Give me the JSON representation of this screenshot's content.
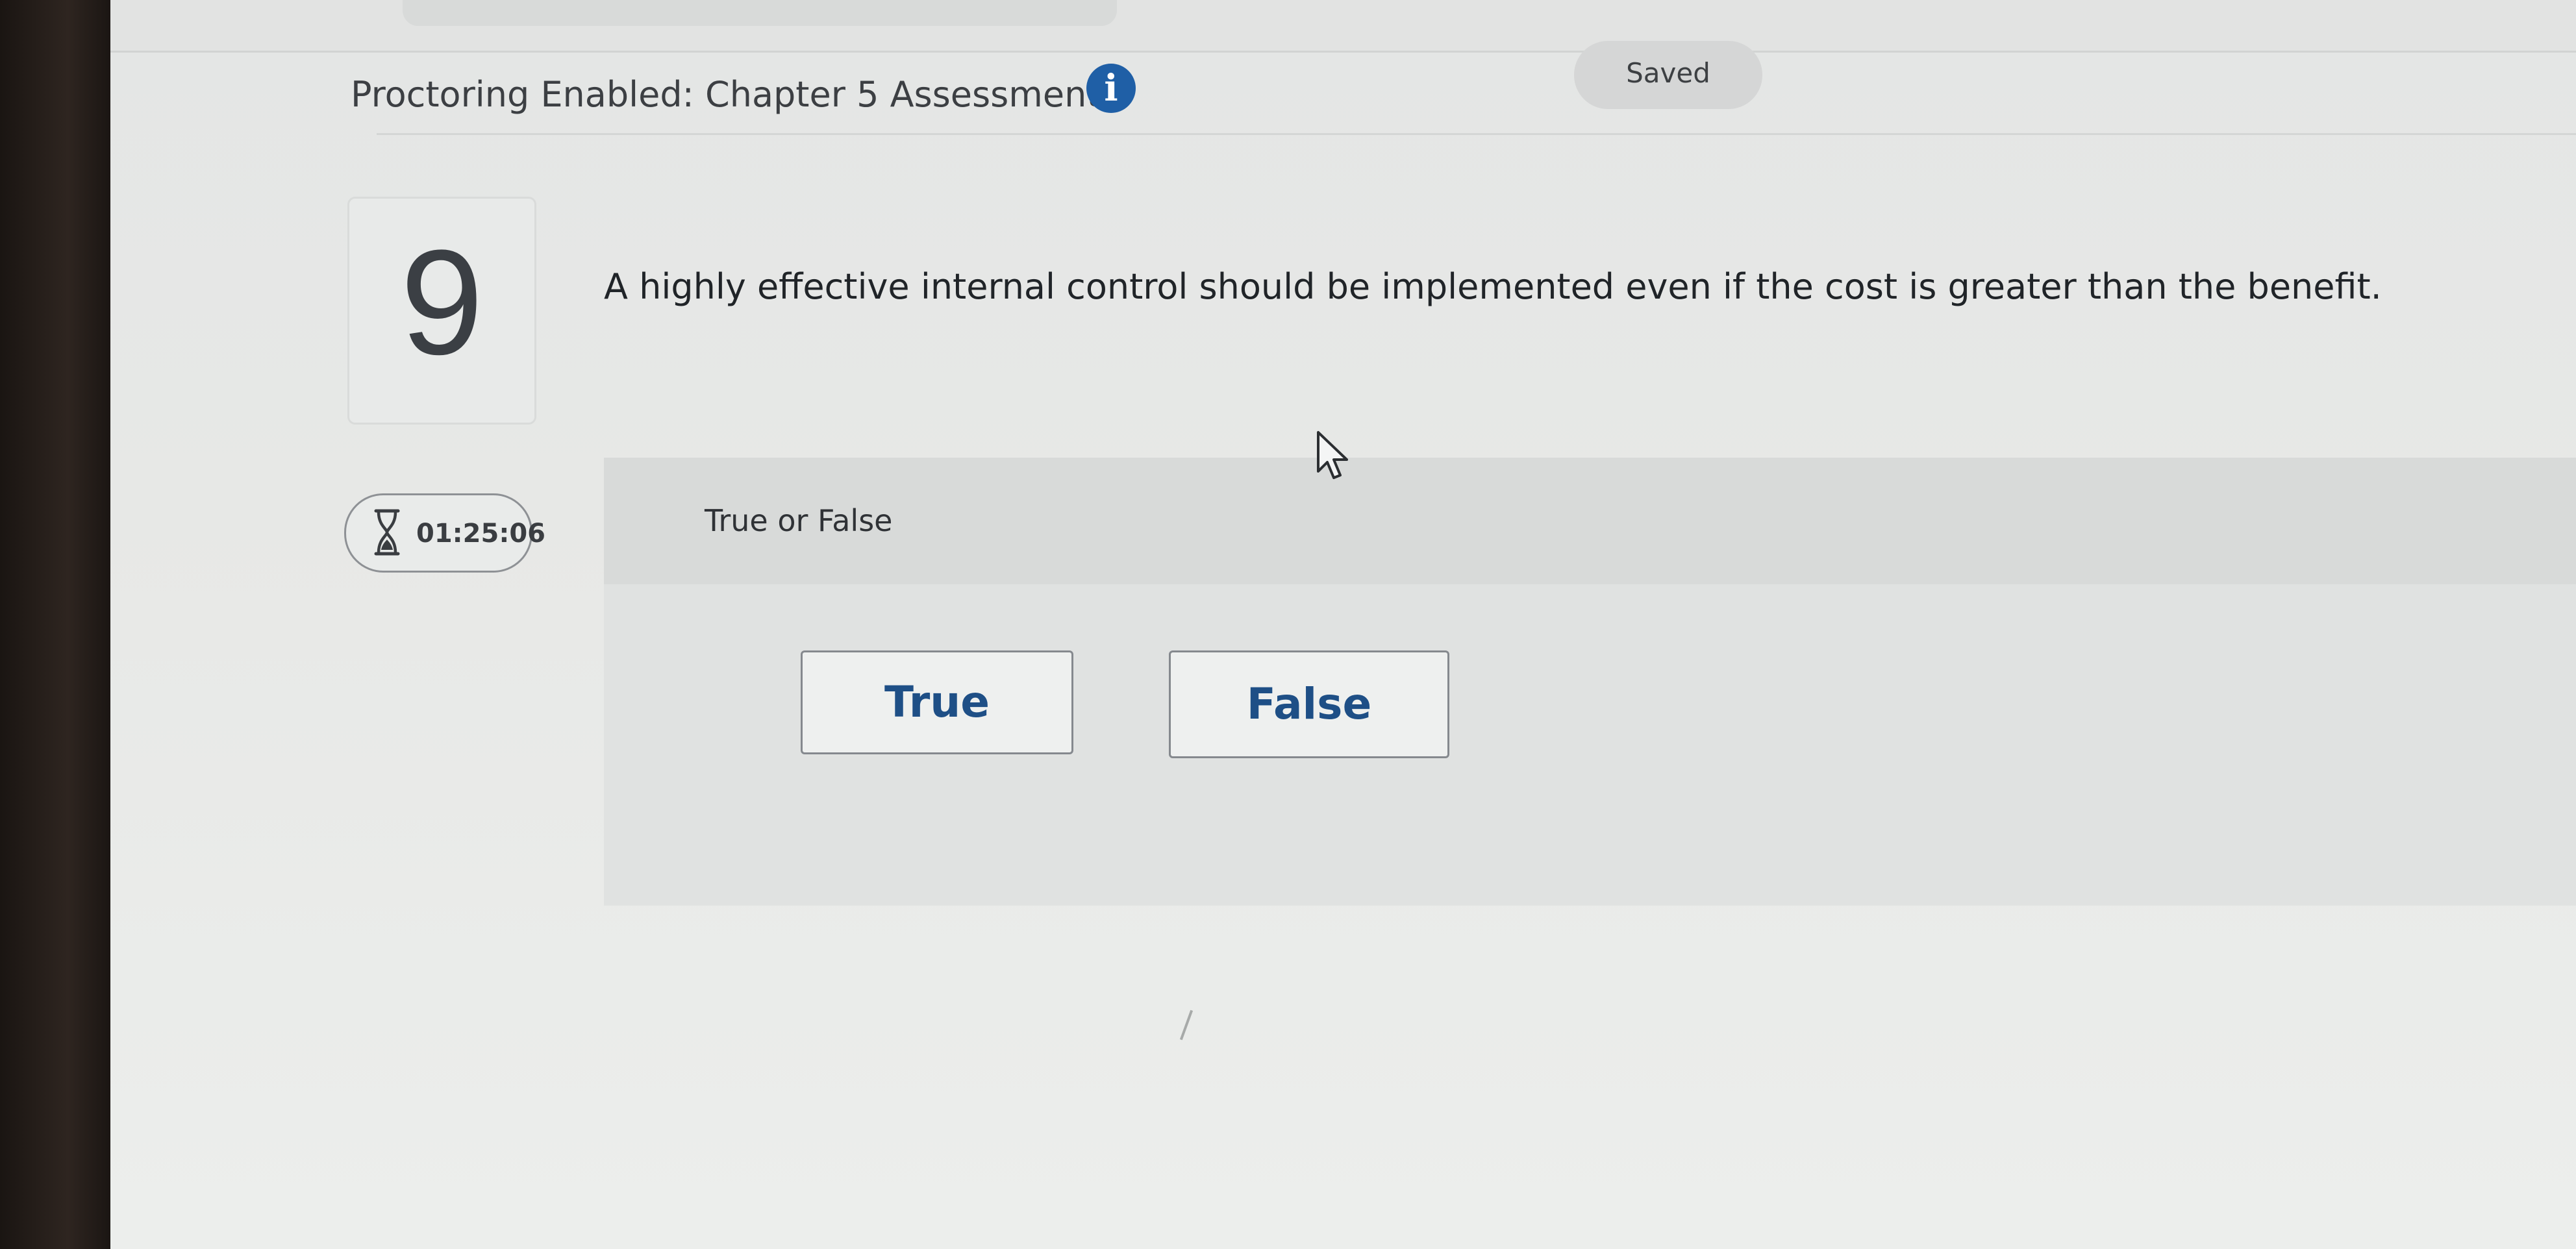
{
  "header": {
    "title": "Proctoring Enabled: Chapter 5 Assessment",
    "info_icon": "info-icon",
    "status": "Saved"
  },
  "question": {
    "number": "9",
    "text": "A highly effective internal control should be implemented even if the cost is greater than the benefit."
  },
  "timer": {
    "icon": "hourglass-icon",
    "value": "01:25:06"
  },
  "answer": {
    "type_label": "True or False",
    "choices": [
      {
        "label": "True"
      },
      {
        "label": "False"
      }
    ]
  },
  "colors": {
    "accent": "#1f5fa6",
    "button_text": "#1e4f86",
    "background": "#e7e8e6"
  }
}
